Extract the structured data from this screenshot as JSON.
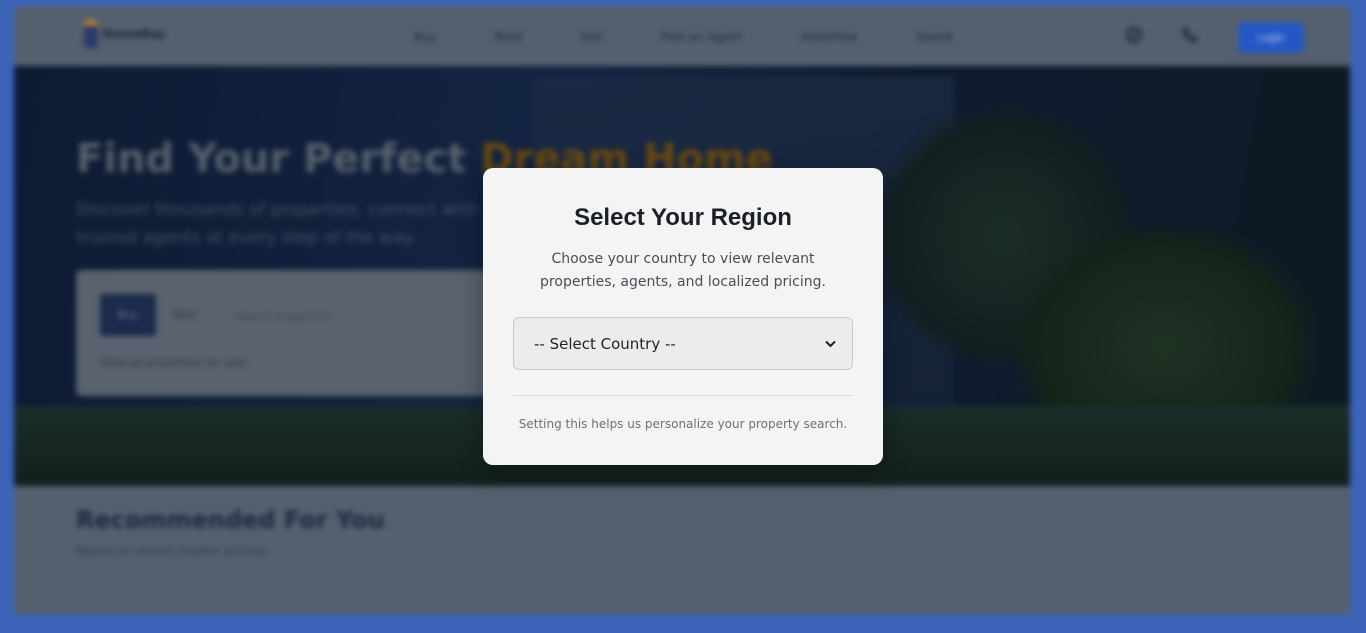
{
  "nav": {
    "brand": "HomeBay",
    "links": [
      "Buy",
      "Rent",
      "Sell",
      "Find an Agent",
      "Advertise",
      "Saved"
    ],
    "login_label": "Login"
  },
  "hero": {
    "title_main": "Find Your Perfect ",
    "title_accent": "Dream Home",
    "subtitle": "Discover thousands of properties, connect with trusted agents at every step of the way.",
    "tab_buy": "Buy",
    "tab_rent": "Rent",
    "search_placeholder": "Search properties...",
    "search_note": "View all properties for sale"
  },
  "recommended": {
    "title": "Recommended For You",
    "subtitle": "Based on recent market activity"
  },
  "modal": {
    "title": "Select Your Region",
    "description": "Choose your country to view relevant properties, agents, and localized pricing.",
    "select_value": "-- Select Country --",
    "footer": "Setting this helps us personalize your property search."
  },
  "colors": {
    "accent": "#2557c4",
    "accent_gold": "#d8902b",
    "modal_bg": "#f4f4f4"
  },
  "icons": [
    "globe-icon",
    "phone-icon",
    "chevron-down-icon"
  ]
}
